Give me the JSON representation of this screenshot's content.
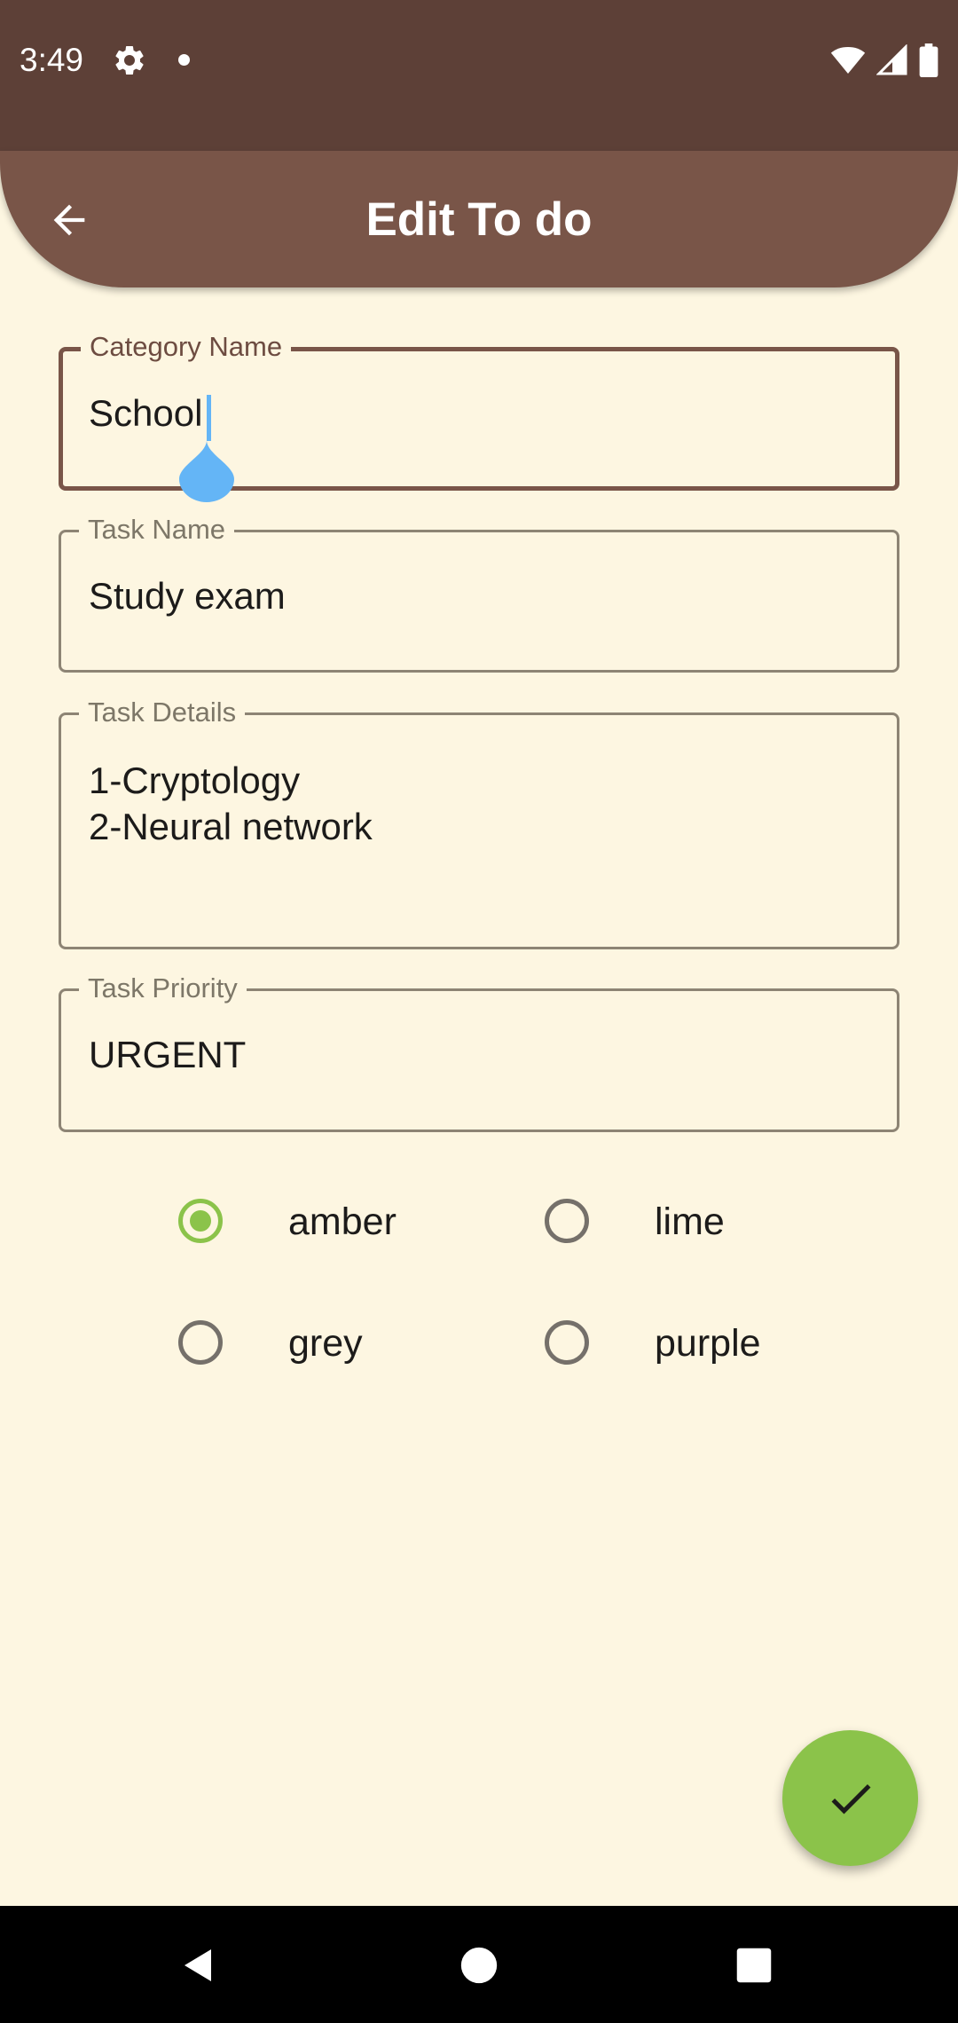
{
  "status_bar": {
    "time": "3:49",
    "icons": [
      "gear-icon",
      "notification-dot-icon",
      "wifi-icon",
      "cellular-signal-icon",
      "battery-icon"
    ]
  },
  "app_bar": {
    "title": "Edit To do",
    "back_icon": "arrow-back-icon"
  },
  "form": {
    "category": {
      "label": "Category Name",
      "value": "School"
    },
    "task_name": {
      "label": "Task Name",
      "value": "Study exam"
    },
    "task_details": {
      "label": "Task Details",
      "value": "1-Cryptology\n2-Neural network"
    },
    "task_priority": {
      "label": "Task Priority",
      "value": "URGENT"
    }
  },
  "color_options": [
    {
      "label": "amber",
      "selected": true
    },
    {
      "label": "lime",
      "selected": false
    },
    {
      "label": "grey",
      "selected": false
    },
    {
      "label": "purple",
      "selected": false
    }
  ],
  "fab": {
    "icon": "check-icon"
  },
  "nav_bar": {
    "icons": [
      "nav-back-icon",
      "nav-home-icon",
      "nav-recents-icon"
    ]
  },
  "colors": {
    "status_bar": "#5D4037",
    "app_bar": "#795548",
    "background": "#FDF6E1",
    "accent": "#8BC34A",
    "cursor": "#64B5F6"
  }
}
